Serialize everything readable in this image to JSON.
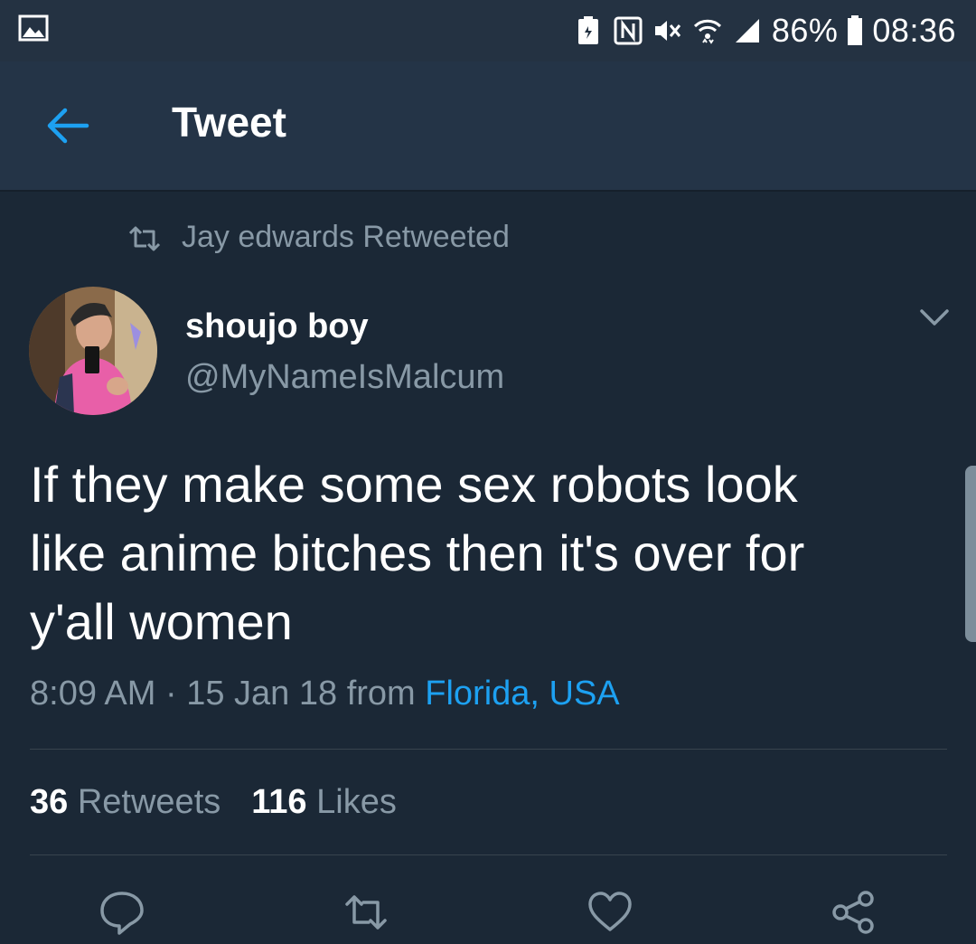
{
  "status_bar": {
    "battery_percent": "86%",
    "time": "08:36",
    "icons": [
      "gallery-icon",
      "battery-saver-icon",
      "nfc-icon",
      "mute-icon",
      "wifi-icon",
      "signal-icon",
      "battery-icon"
    ]
  },
  "header": {
    "title": "Tweet",
    "back_icon": "back-arrow-icon"
  },
  "retweet_context": {
    "text": "Jay edwards Retweeted"
  },
  "tweet": {
    "display_name": "shoujo boy",
    "handle": "@MyNameIsMalcum",
    "text": "If they make some sex robots look\nlike anime bitches then it's over for\ny'all women",
    "time": "8:09 AM",
    "separator": "·",
    "date": "15 Jan 18",
    "from_label": "from",
    "location": "Florida, USA"
  },
  "stats": {
    "retweets_count": "36",
    "retweets_label": "Retweets",
    "likes_count": "116",
    "likes_label": "Likes"
  },
  "actions": [
    "reply-icon",
    "retweet-icon",
    "like-icon",
    "share-icon"
  ],
  "colors": {
    "background": "#1b2836",
    "header": "#243447",
    "accent": "#1da1f2",
    "secondary_text": "#8899a6"
  }
}
